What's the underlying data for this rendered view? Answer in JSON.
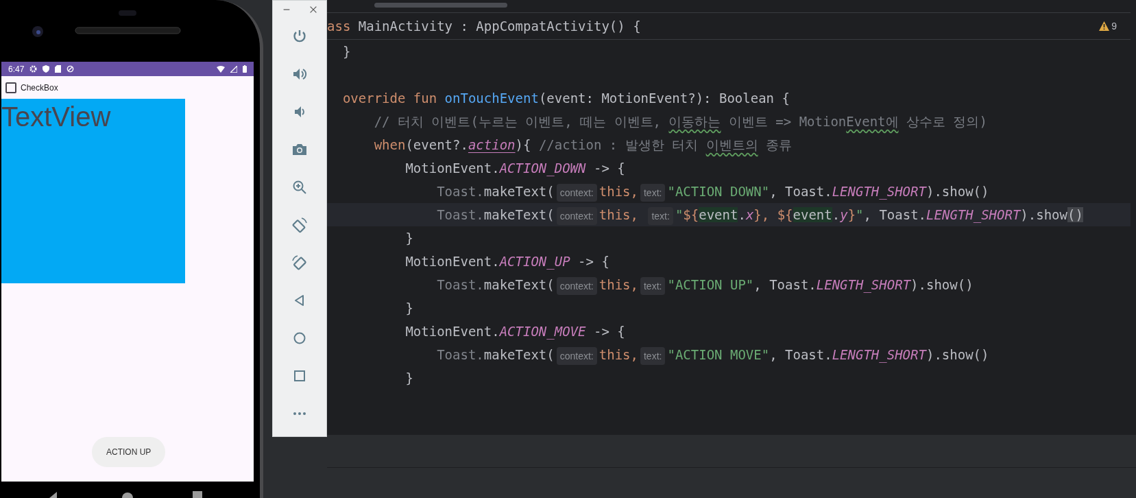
{
  "phone": {
    "status_bar": {
      "time": "6:47"
    },
    "checkbox": {
      "label": "CheckBox",
      "checked": false
    },
    "text_view": {
      "text": "TextView"
    },
    "toast": {
      "text": "ACTION UP"
    }
  },
  "editor": {
    "sticky_header": [
      {
        "kind": "keyword",
        "text": "ass"
      },
      {
        "kind": "plain",
        "text": " MainActivity : AppCompatActivity() {"
      }
    ],
    "warning_count": "9",
    "lines": [
      {
        "kind": "code",
        "current": false,
        "segments": [
          {
            "kind": "plain",
            "text": "  }"
          }
        ]
      },
      {
        "kind": "blank"
      },
      {
        "kind": "code",
        "current": false,
        "segments": [
          {
            "kind": "keyword",
            "text": "  override fun "
          },
          {
            "kind": "function",
            "text": "onTouchEvent"
          },
          {
            "kind": "plain",
            "text": "(event: MotionEvent?): Boolean {"
          }
        ]
      },
      {
        "kind": "code",
        "current": false,
        "segments": [
          {
            "kind": "comment",
            "text": "      // 터치 이벤트(누르는 이벤트, 떼는 이벤트, "
          },
          {
            "kind": "typo",
            "text": "이동하는"
          },
          {
            "kind": "comment",
            "text": " 이벤트 => Motion"
          },
          {
            "kind": "typo",
            "text": "Event에"
          },
          {
            "kind": "comment",
            "text": " 상수로 정의)"
          }
        ]
      },
      {
        "kind": "code",
        "current": false,
        "segments": [
          {
            "kind": "keyword",
            "text": "      when"
          },
          {
            "kind": "plain",
            "text": "(event?."
          },
          {
            "kind": "property",
            "text": "action"
          },
          {
            "kind": "plain",
            "text": "){ "
          },
          {
            "kind": "comment",
            "text": "//action : 발생한 터치 "
          },
          {
            "kind": "typo",
            "text": "이벤트의"
          },
          {
            "kind": "comment",
            "text": " 종류"
          }
        ]
      },
      {
        "kind": "code",
        "current": false,
        "segments": [
          {
            "kind": "plain",
            "text": "          MotionEvent."
          },
          {
            "kind": "constant",
            "text": "ACTION_DOWN"
          },
          {
            "kind": "plain",
            "text": " -> {"
          }
        ]
      },
      {
        "kind": "code",
        "current": false,
        "segments": [
          {
            "kind": "dim",
            "text": "              Toast."
          },
          {
            "kind": "plain",
            "text": "makeText("
          },
          {
            "kind": "hint",
            "text": "context:"
          },
          {
            "kind": "keyword",
            "text": "this,"
          },
          {
            "kind": "hint",
            "text": "text:"
          },
          {
            "kind": "string",
            "text": "\"ACTION DOWN\""
          },
          {
            "kind": "plain",
            "text": ", Toast."
          },
          {
            "kind": "constant",
            "text": "LENGTH_SHORT"
          },
          {
            "kind": "plain",
            "text": ").show()"
          }
        ]
      },
      {
        "kind": "code",
        "current": true,
        "segments": [
          {
            "kind": "dim",
            "text": "              Toast."
          },
          {
            "kind": "plain",
            "text": "makeText("
          },
          {
            "kind": "hint",
            "text": "context:"
          },
          {
            "kind": "keyword",
            "text": "this, "
          },
          {
            "kind": "hint",
            "text": "text:"
          },
          {
            "kind": "string",
            "text": "\""
          },
          {
            "kind": "template",
            "text": "${"
          },
          {
            "kind": "template_var",
            "text": "event"
          },
          {
            "kind": "plain",
            "text": "."
          },
          {
            "kind": "constant",
            "text": "x"
          },
          {
            "kind": "template",
            "text": "}, ${"
          },
          {
            "kind": "template_var",
            "text": "event"
          },
          {
            "kind": "plain",
            "text": "."
          },
          {
            "kind": "constant",
            "text": "y"
          },
          {
            "kind": "template",
            "text": "}"
          },
          {
            "kind": "string",
            "text": "\""
          },
          {
            "kind": "plain",
            "text": ", Toast."
          },
          {
            "kind": "constant",
            "text": "LENGTH_SHORT"
          },
          {
            "kind": "plain",
            "text": ").show"
          },
          {
            "kind": "brace_match",
            "text": "()"
          }
        ]
      },
      {
        "kind": "code",
        "current": false,
        "segments": [
          {
            "kind": "plain",
            "text": "          }"
          }
        ]
      },
      {
        "kind": "code",
        "current": false,
        "segments": [
          {
            "kind": "plain",
            "text": "          MotionEvent."
          },
          {
            "kind": "constant",
            "text": "ACTION_UP"
          },
          {
            "kind": "plain",
            "text": " -> {"
          }
        ]
      },
      {
        "kind": "code",
        "current": false,
        "segments": [
          {
            "kind": "dim",
            "text": "              Toast."
          },
          {
            "kind": "plain",
            "text": "makeText("
          },
          {
            "kind": "hint",
            "text": "context:"
          },
          {
            "kind": "keyword",
            "text": "this,"
          },
          {
            "kind": "hint",
            "text": "text:"
          },
          {
            "kind": "string",
            "text": "\"ACTION UP\""
          },
          {
            "kind": "plain",
            "text": ", Toast."
          },
          {
            "kind": "constant",
            "text": "LENGTH_SHORT"
          },
          {
            "kind": "plain",
            "text": ").show()"
          }
        ]
      },
      {
        "kind": "code",
        "current": false,
        "segments": [
          {
            "kind": "plain",
            "text": "          }"
          }
        ]
      },
      {
        "kind": "code",
        "current": false,
        "segments": [
          {
            "kind": "plain",
            "text": "          MotionEvent."
          },
          {
            "kind": "constant",
            "text": "ACTION_MOVE"
          },
          {
            "kind": "plain",
            "text": " -> {"
          }
        ]
      },
      {
        "kind": "code",
        "current": false,
        "segments": [
          {
            "kind": "dim",
            "text": "              Toast."
          },
          {
            "kind": "plain",
            "text": "makeText("
          },
          {
            "kind": "hint",
            "text": "context:"
          },
          {
            "kind": "keyword",
            "text": "this,"
          },
          {
            "kind": "hint",
            "text": "text:"
          },
          {
            "kind": "string",
            "text": "\"ACTION MOVE\""
          },
          {
            "kind": "plain",
            "text": ", Toast."
          },
          {
            "kind": "constant",
            "text": "LENGTH_SHORT"
          },
          {
            "kind": "plain",
            "text": ").show()"
          }
        ]
      },
      {
        "kind": "code",
        "current": false,
        "segments": [
          {
            "kind": "plain",
            "text": "          }"
          }
        ]
      }
    ]
  }
}
